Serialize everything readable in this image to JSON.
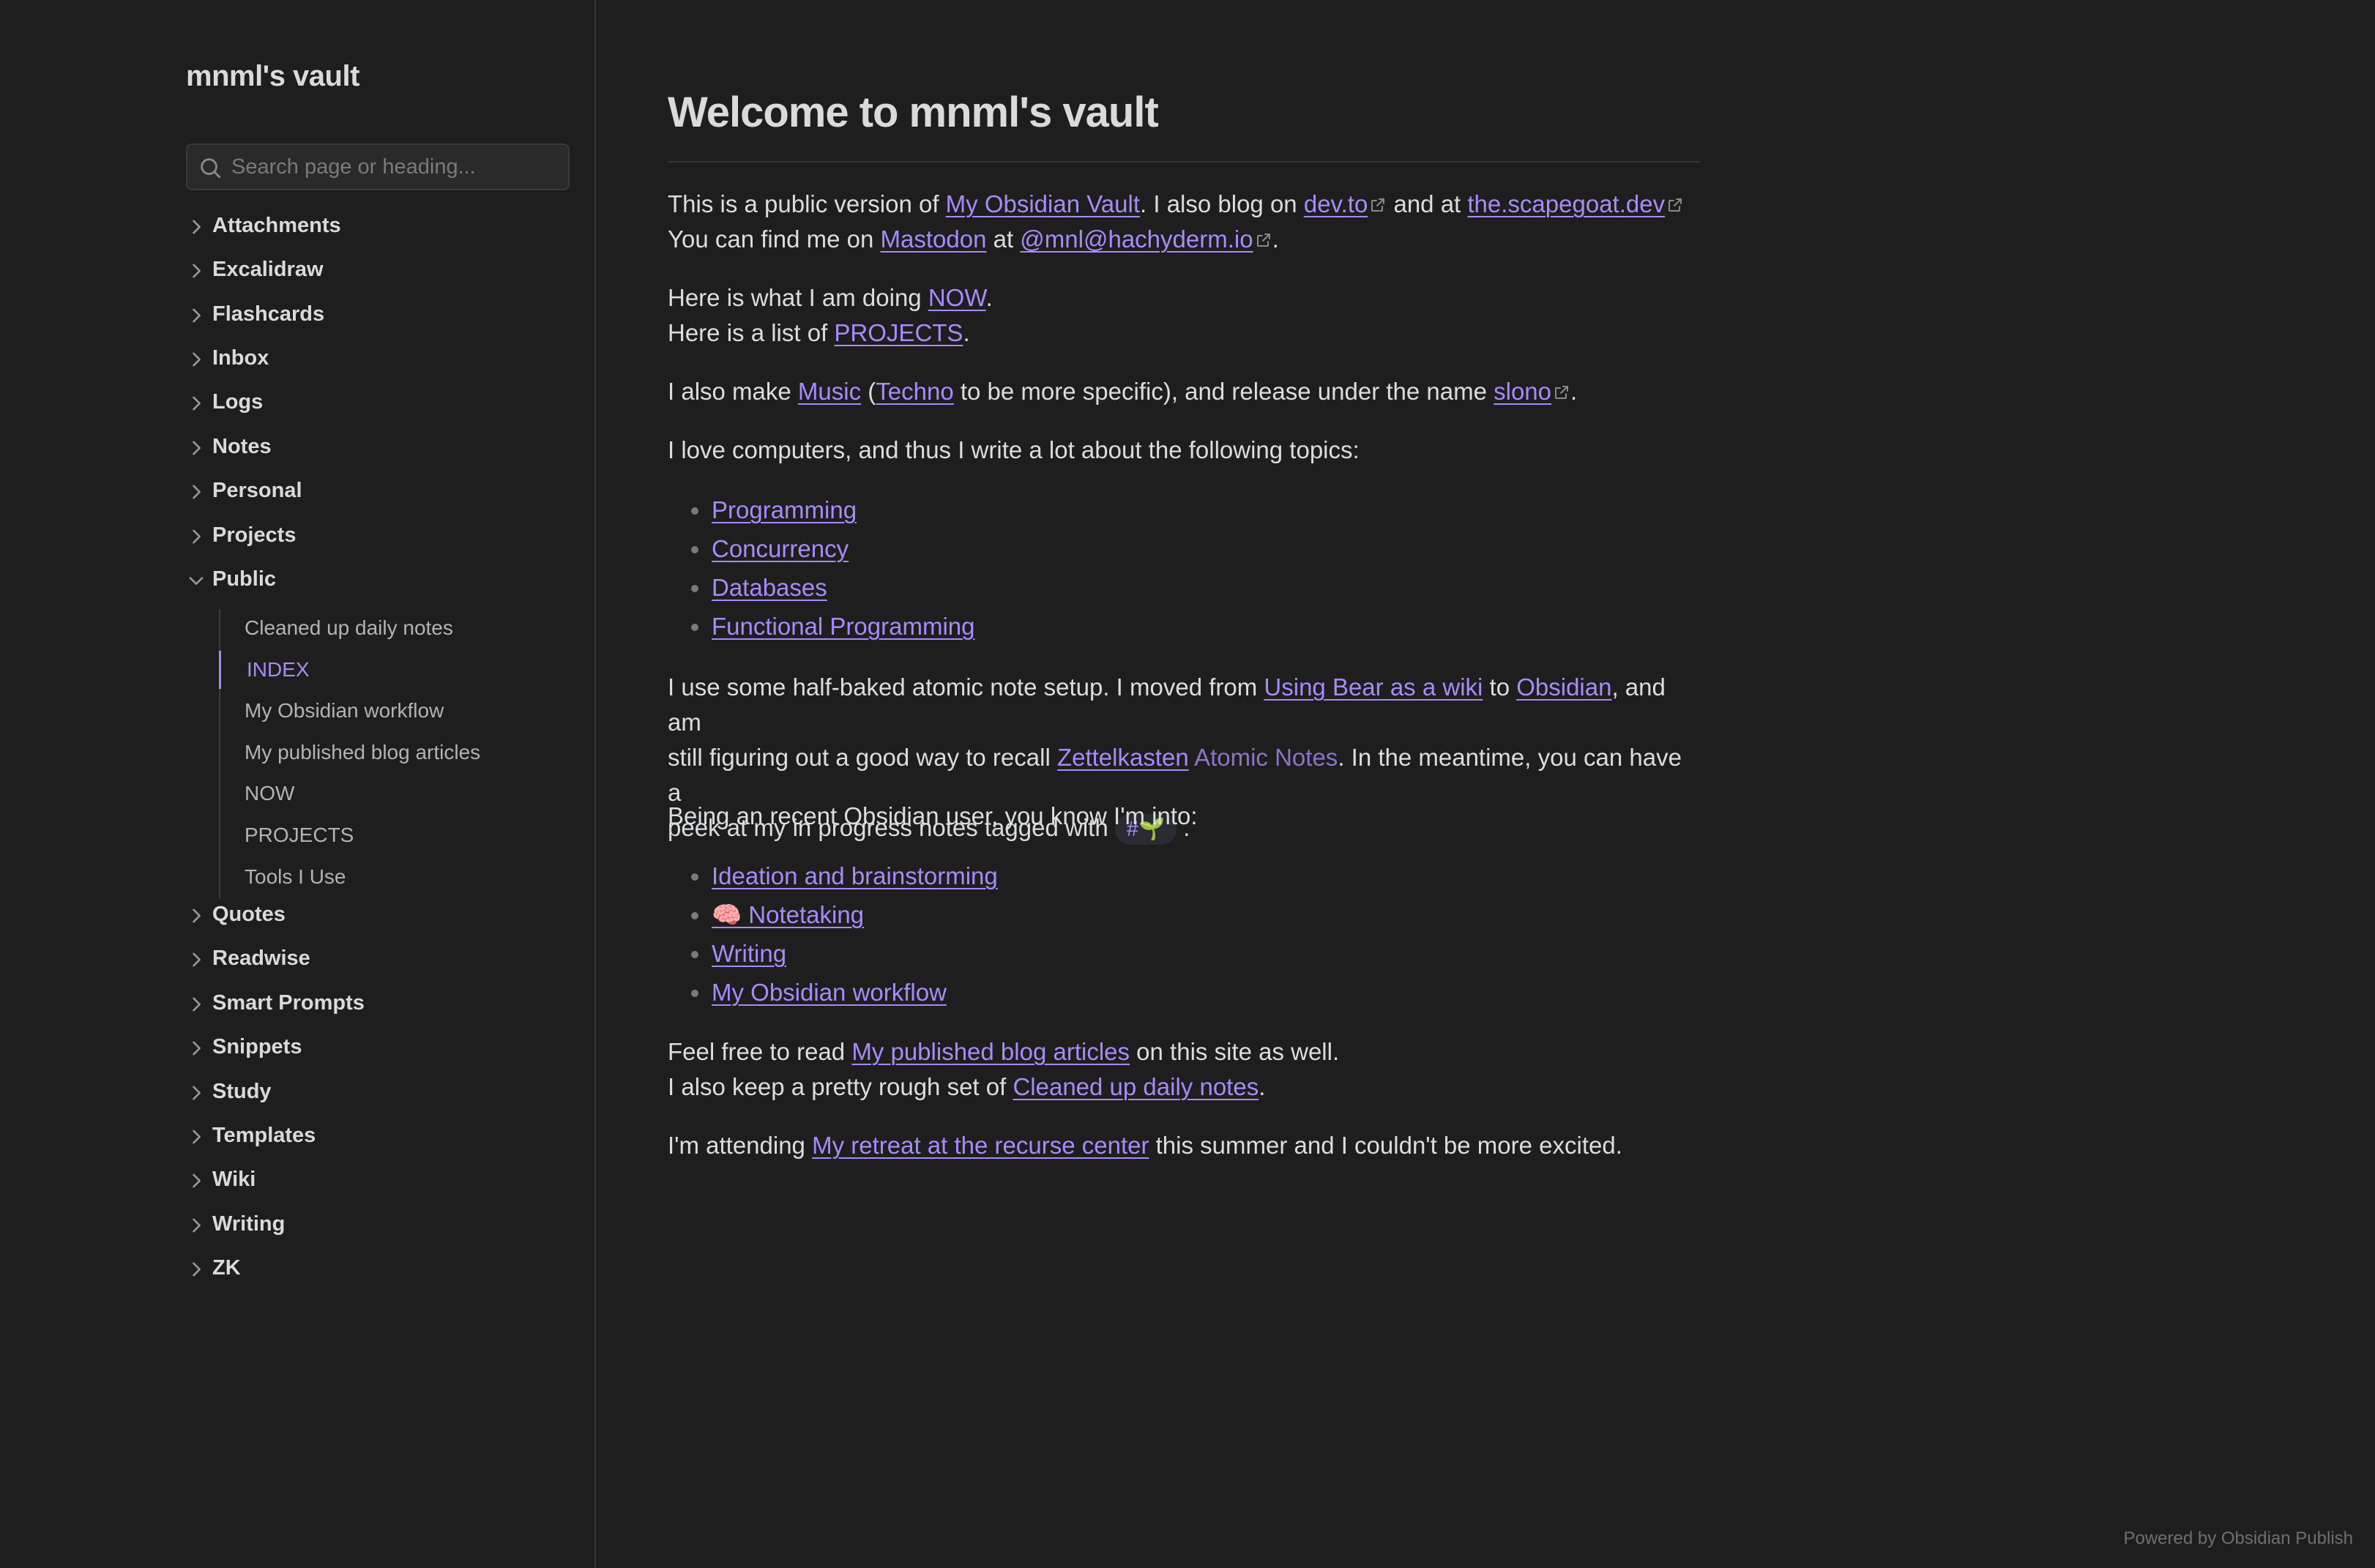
{
  "site": {
    "name": "mnml's vault"
  },
  "search": {
    "placeholder": "Search page or heading..."
  },
  "folders_top": [
    "Attachments",
    "Excalidraw",
    "Flashcards",
    "Inbox",
    "Logs",
    "Notes",
    "Personal",
    "Projects"
  ],
  "public_folder": {
    "label": "Public",
    "files": [
      "Cleaned up daily notes",
      "INDEX",
      "My Obsidian workflow",
      "My published blog articles",
      "NOW",
      "PROJECTS",
      "Tools I Use"
    ],
    "active": "INDEX"
  },
  "folders_bottom": [
    "Quotes",
    "Readwise",
    "Smart Prompts",
    "Snippets",
    "Study",
    "Templates",
    "Wiki",
    "Writing",
    "ZK"
  ],
  "article": {
    "title": "Welcome to mnml's vault",
    "p1": {
      "t1": "This is a public version of ",
      "l1": "My Obsidian Vault",
      "t2": ". I also blog on ",
      "l2": "dev.to",
      "t3": " and at ",
      "l3": "the.scapegoat.dev",
      "t4": "You can find me on ",
      "l4": "Mastodon",
      "t5": " at ",
      "l5": "@mnl@hachyderm.io",
      "t6": "."
    },
    "p2": {
      "t1": "Here is what I am doing ",
      "l1": "NOW",
      "t2": ".",
      "t3": "Here is a list of ",
      "l2": "PROJECTS",
      "t4": "."
    },
    "p3": {
      "t1": "I also make ",
      "l1": "Music",
      "t2": " (",
      "l2": "Techno",
      "t3": " to be more specific), and release under the name ",
      "l3": "slono",
      "t4": "."
    },
    "p4": "I love computers, and thus I write a lot about the following topics:",
    "topics": [
      "Programming",
      "Concurrency",
      "Databases",
      "Functional Programming"
    ],
    "p5": {
      "t1": "I use some half-baked atomic note setup. I moved from ",
      "l1": "Using Bear as a wiki",
      "t2": " to ",
      "l2": "Obsidian",
      "t3": ", and am",
      "t4": "still figuring out a good way to recall ",
      "l3": "Zettelkasten",
      "l4": "Atomic Notes",
      "t5": ". In the meantime, you can have a",
      "t6": "peek at my in progress notes tagged with ",
      "tag": "#🌱",
      "t7": " ."
    },
    "p6": "Being an recent Obsidian user, you know I'm into:",
    "interests": [
      "Ideation and brainstorming",
      "🧠 Notetaking",
      "Writing",
      "My Obsidian workflow"
    ],
    "p7": {
      "t1": "Feel free to read ",
      "l1": "My published blog articles",
      "t2": " on this site as well.",
      "t3": "I also keep a pretty rough set of ",
      "l2": "Cleaned up daily notes",
      "t4": "."
    },
    "p8": {
      "t1": "I'm attending ",
      "l1": "My retreat at the recurse center",
      "t2": " this summer and I couldn't be more excited."
    }
  },
  "footer": "Powered by Obsidian Publish",
  "colors": {
    "background": "#1e1e1e",
    "accent": "#a88bfa",
    "text": "#dcddde"
  }
}
